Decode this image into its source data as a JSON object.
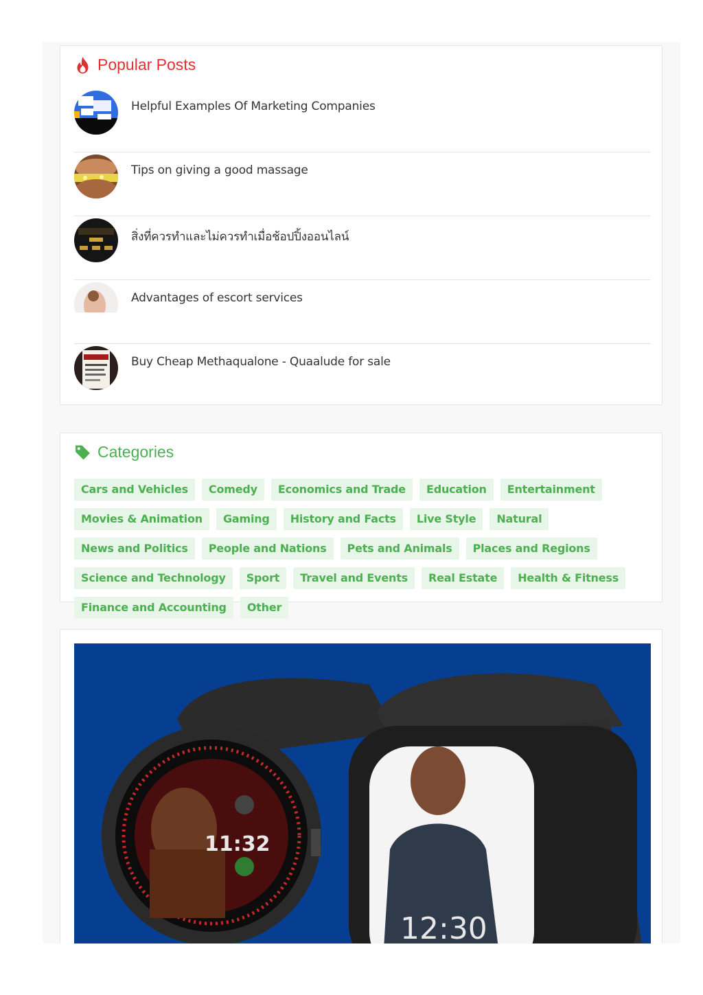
{
  "popular": {
    "title": "Popular Posts",
    "icon": "fire-icon",
    "accent": "#e03131",
    "posts": [
      {
        "title": "Helpful Examples Of Marketing Companies"
      },
      {
        "title": "Tips on giving a good massage"
      },
      {
        "title": "สิ่งที่ควรทำและไม่ควรทำเมื่อช้อปปิ้งออนไลน์"
      },
      {
        "title": "Advantages of escort services"
      },
      {
        "title": "Buy Cheap Methaqualone - Quaalude for sale"
      }
    ]
  },
  "categories": {
    "title": "Categories",
    "icon": "tag-icon",
    "accent": "#4caf50",
    "items": [
      "Cars and Vehicles",
      "Comedy",
      "Economics and Trade",
      "Education",
      "Entertainment",
      "Movies & Animation",
      "Gaming",
      "History and Facts",
      "Live Style",
      "Natural",
      "News and Politics",
      "People and Nations",
      "Pets and Animals",
      "Places and Regions",
      "Science and Technology",
      "Sport",
      "Travel and Events",
      "Real Estate",
      "Health & Fitness",
      "Finance and Accounting",
      "Other"
    ]
  },
  "ad": {
    "round_watch_time": "11:32",
    "square_watch_time": "12:30",
    "background": "#063f92"
  }
}
